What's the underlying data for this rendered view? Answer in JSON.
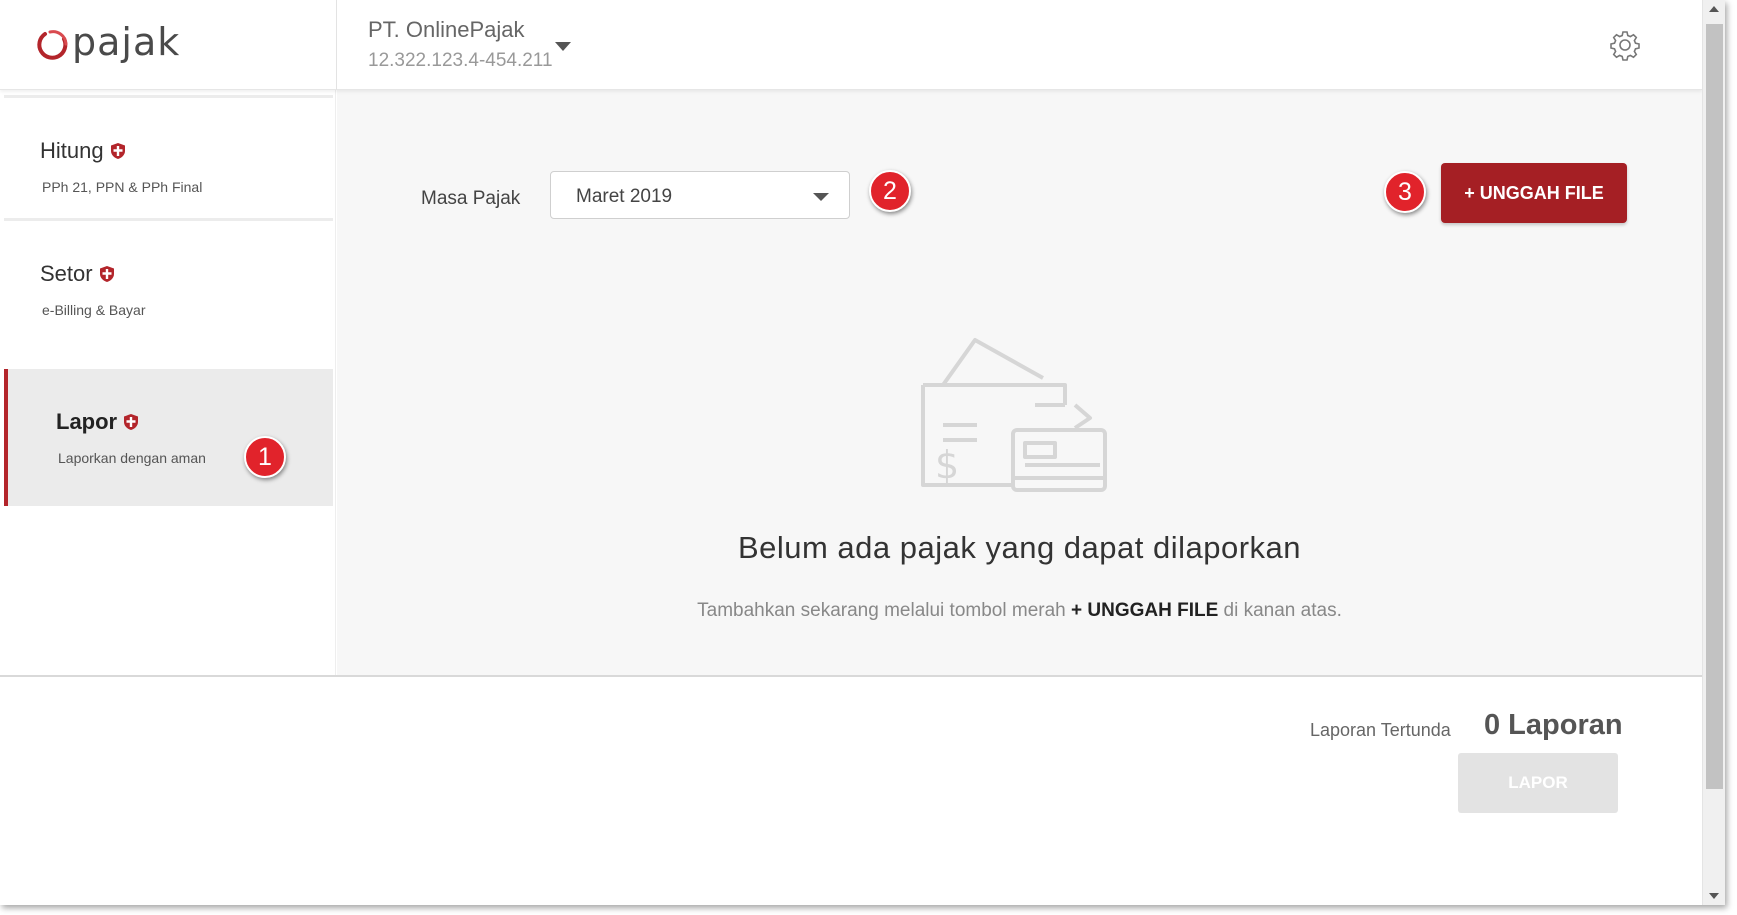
{
  "app": {
    "logo_text": "pajak"
  },
  "header": {
    "company_name": "PT. OnlinePajak",
    "company_npwp": "12.322.123.4-454.211"
  },
  "sidebar": {
    "items": [
      {
        "title": "Hitung",
        "subtitle": "PPh 21, PPN & PPh Final",
        "active": false
      },
      {
        "title": "Setor",
        "subtitle": "e-Billing & Bayar",
        "active": false
      },
      {
        "title": "Lapor",
        "subtitle": "Laporkan dengan aman",
        "active": true
      }
    ]
  },
  "main": {
    "masa_label": "Masa Pajak",
    "masa_value": "Maret 2019",
    "upload_label": "+ UNGGAH FILE",
    "empty_title": "Belum ada pajak yang dapat dilaporkan",
    "empty_hint_prefix": "Tambahkan sekarang melalui tombol merah ",
    "empty_hint_bold": "+ UNGGAH FILE",
    "empty_hint_suffix": " di kanan atas."
  },
  "footer": {
    "pending_label": "Laporan Tertunda",
    "pending_count": "0 Laporan",
    "lapor_label": "LAPOR"
  },
  "callouts": [
    "1",
    "2",
    "3"
  ],
  "colors": {
    "brand_red": "#a51f24",
    "callout_red": "#e1232b",
    "active_border": "#b3252b"
  }
}
